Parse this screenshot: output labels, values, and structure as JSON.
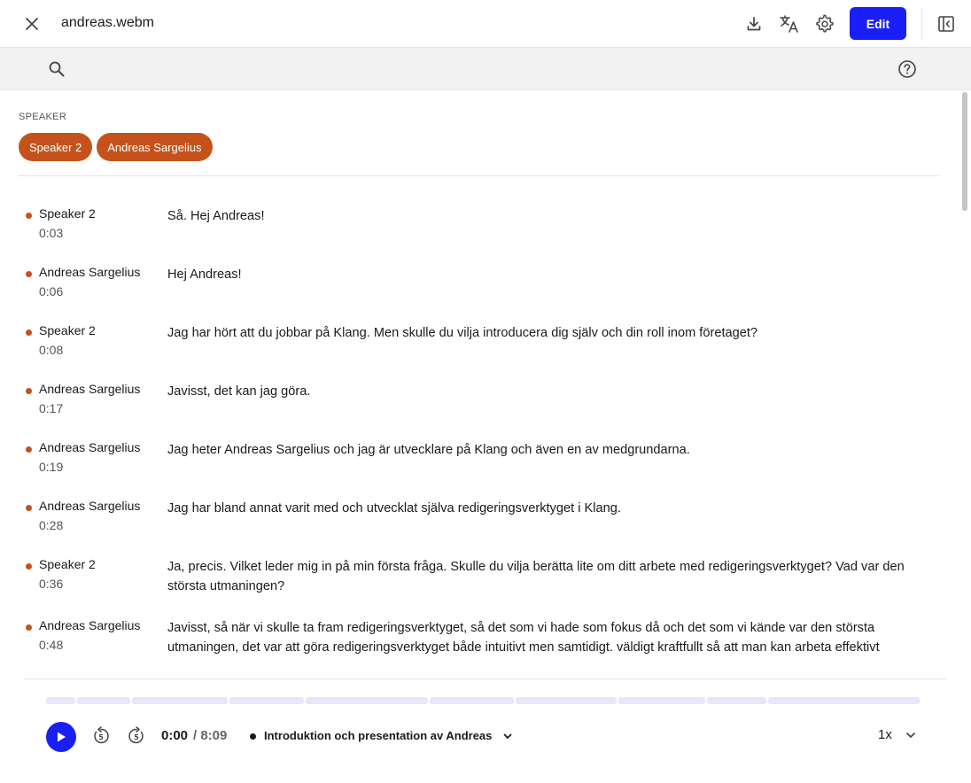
{
  "header": {
    "filename": "andreas.webm",
    "edit_label": "Edit"
  },
  "speakers_section": {
    "label": "SPEAKER",
    "chips": [
      "Speaker 2",
      "Andreas Sargelius"
    ]
  },
  "colors": {
    "accent": "#1a1ff5",
    "speaker_chip": "#c5521b"
  },
  "segments": [
    {
      "speaker": "Speaker 2",
      "time": "0:03",
      "text": "Så. Hej Andreas!"
    },
    {
      "speaker": "Andreas Sargelius",
      "time": "0:06",
      "text": "Hej Andreas!"
    },
    {
      "speaker": "Speaker 2",
      "time": "0:08",
      "text": "Jag har hört att du jobbar på Klang. Men skulle du vilja introducera dig själv och din roll inom företaget?"
    },
    {
      "speaker": "Andreas Sargelius",
      "time": "0:17",
      "text": "Javisst, det kan jag göra."
    },
    {
      "speaker": "Andreas Sargelius",
      "time": "0:19",
      "text": "Jag heter Andreas Sargelius och jag är utvecklare på Klang och även en av medgrundarna."
    },
    {
      "speaker": "Andreas Sargelius",
      "time": "0:28",
      "text": "Jag har bland annat varit med och utvecklat själva redigeringsverktyget i Klang."
    },
    {
      "speaker": "Speaker 2",
      "time": "0:36",
      "text": "Ja, precis. Vilket leder mig in på min första fråga. Skulle du vilja berätta lite om ditt arbete med redigeringsverktyget? Vad var den största utmaningen?"
    },
    {
      "speaker": "Andreas Sargelius",
      "time": "0:48",
      "text": "Javisst, så när vi skulle ta fram redigeringsverktyget, så det som vi hade som fokus då och det som vi kände var den största utmaningen, det var att göra redigeringsverktyget både intuitivt men samtidigt. väldigt kraftfullt så att man kan arbeta effektivt"
    }
  ],
  "player": {
    "current_time": "0:00",
    "duration_text": "/ 8:09",
    "chapter_title": "Introduktion och presentation av Andreas",
    "speed": "1x"
  },
  "icons": {
    "close": "close-icon",
    "download": "download-icon",
    "translate": "translate-icon",
    "settings": "gear-icon",
    "sidebar": "sidebar-toggle-icon",
    "search": "search-icon",
    "help": "help-icon",
    "play": "play-icon",
    "rewind": "rewind-5-icon",
    "forward": "forward-5-icon"
  }
}
